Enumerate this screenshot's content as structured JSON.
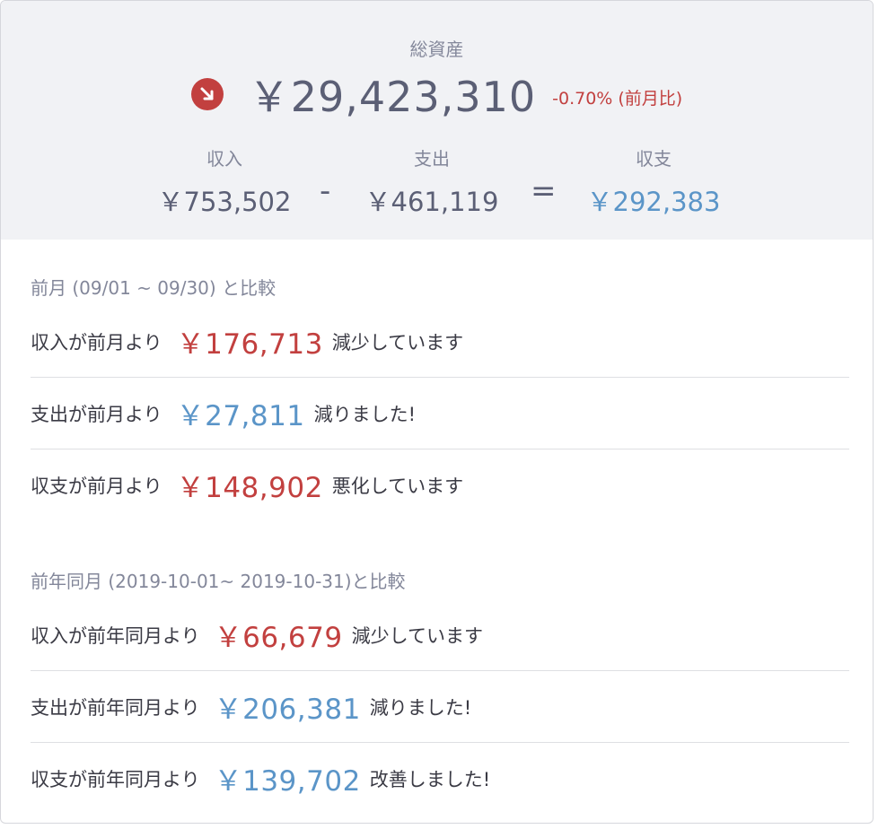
{
  "summary": {
    "total_assets_label": "総資産",
    "total_assets_value": "￥29,423,310",
    "change_text": "-0.70% (前月比)",
    "trend_icon": "arrow-down-right-icon",
    "income_label": "収入",
    "income_value": "￥753,502",
    "minus_symbol": "-",
    "expense_label": "支出",
    "expense_value": "￥461,119",
    "equals_symbol": "=",
    "balance_label": "収支",
    "balance_value": "￥292,383"
  },
  "month_comparison": {
    "title": "前月 (09/01 ~ 09/30) と比較",
    "rows": [
      {
        "lead": "収入が前月より",
        "amount": "￥176,713",
        "tail": "減少しています",
        "tone": "negative"
      },
      {
        "lead": "支出が前月より",
        "amount": "￥27,811",
        "tail": "減りました!",
        "tone": "positive"
      },
      {
        "lead": "収支が前月より",
        "amount": "￥148,902",
        "tail": "悪化しています",
        "tone": "negative"
      }
    ]
  },
  "year_comparison": {
    "title": "前年同月 (2019-10-01~ 2019-10-31)と比較",
    "rows": [
      {
        "lead": "収入が前年同月より",
        "amount": "￥66,679",
        "tail": "減少しています",
        "tone": "negative"
      },
      {
        "lead": "支出が前年同月より",
        "amount": "￥206,381",
        "tail": "減りました!",
        "tone": "positive"
      },
      {
        "lead": "収支が前年同月より",
        "amount": "￥139,702",
        "tail": "改善しました!",
        "tone": "positive"
      }
    ]
  },
  "colors": {
    "negative": "#c2403f",
    "positive": "#5b95c8",
    "summary_bg": "#f1f2f5"
  }
}
